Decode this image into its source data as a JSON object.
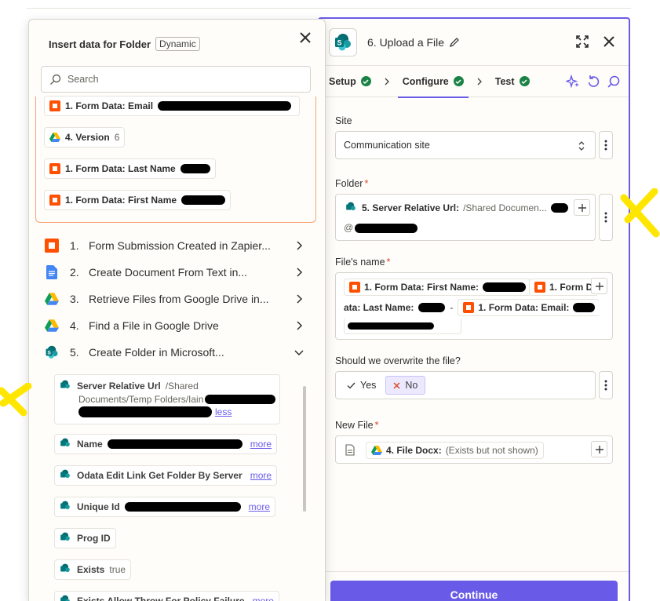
{
  "right_panel": {
    "step_title": "6. Upload a File",
    "tabs": [
      {
        "label": "Setup",
        "status": "complete"
      },
      {
        "label": "Configure",
        "status": "complete",
        "active": true
      },
      {
        "label": "Test",
        "status": "complete"
      }
    ],
    "fields": {
      "site": {
        "label": "Site",
        "value": "Communication site"
      },
      "folder": {
        "label": "Folder",
        "required": "*",
        "pill_key": "5. Server Relative Url:",
        "pill_value": "/Shared Documen...",
        "line2_prefix": "@"
      },
      "files_name": {
        "label": "File's name",
        "required": "*",
        "pill1": "1. Form Data: First Name:",
        "pill2": "1. Form D",
        "line2_text": "ata: Last Name:",
        "line2_sep": "-",
        "pill3": "1. Form Data: Email:"
      },
      "overwrite": {
        "label": "Should we overwrite the file?",
        "yes": "Yes",
        "no": "No"
      },
      "new_file": {
        "label": "New File",
        "required": "*",
        "pill_key": "4. File Docx:",
        "pill_value": "(Exists but not shown)"
      }
    },
    "continue_label": "Continue"
  },
  "popup": {
    "title": "Insert data for Folder",
    "badge": "Dynamic",
    "search_placeholder": "Search",
    "recent": [
      {
        "label": "1. Form Data: Email",
        "value": ""
      },
      {
        "label": "4. Version",
        "value": "6"
      },
      {
        "label": "1. Form Data: Last Name",
        "value": ""
      },
      {
        "label": "1. Form Data: First Name",
        "value": ""
      }
    ],
    "steps": [
      {
        "num": "1.",
        "title": "Form Submission Created in Zapier...",
        "icon": "zapier-forms"
      },
      {
        "num": "2.",
        "title": "Create Document From Text in...",
        "icon": "google-docs"
      },
      {
        "num": "3.",
        "title": "Retrieve Files from Google Drive in...",
        "icon": "google-drive"
      },
      {
        "num": "4.",
        "title": "Find a File in Google Drive",
        "icon": "google-drive"
      },
      {
        "num": "5.",
        "title": "Create Folder in Microsoft...",
        "icon": "sharepoint",
        "expanded": true
      }
    ],
    "data_items": [
      {
        "key": "Server Relative Url",
        "value": "/Shared",
        "value2": "Documents/Temp Folders/Iain",
        "link": "less"
      },
      {
        "key": "Name",
        "value": "",
        "link": "more"
      },
      {
        "key": "Odata Edit Link Get Folder By Server",
        "value": "",
        "link": "more"
      },
      {
        "key": "Unique Id",
        "value": "",
        "link": "more"
      },
      {
        "key": "Prog ID",
        "value": "",
        "link": ""
      },
      {
        "key": "Exists",
        "value": "true",
        "link": ""
      },
      {
        "key": "Exists Allow Throw For Policy Failure",
        "value": "",
        "link": "more"
      }
    ]
  },
  "colors": {
    "accent": "#695be8",
    "success": "#1a8245",
    "zapier_orange": "#ff4f00",
    "annotation": "#ffe600"
  }
}
